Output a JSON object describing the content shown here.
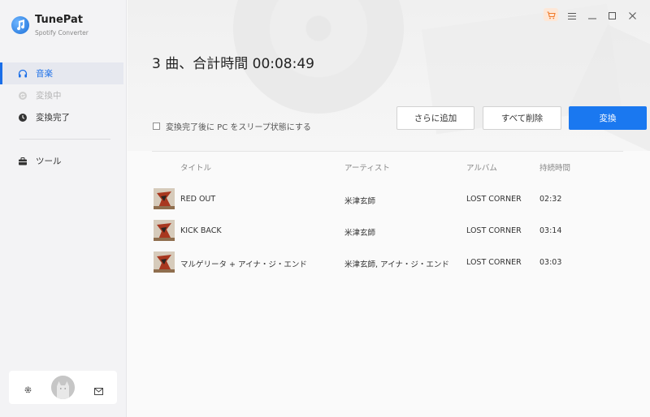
{
  "app": {
    "name": "TunePat",
    "subtitle": "Spotify Converter"
  },
  "sidebar": {
    "items": [
      {
        "label": "音楽",
        "icon": "headphones-icon",
        "state": "active"
      },
      {
        "label": "変換中",
        "icon": "converting-icon",
        "state": "disabled"
      },
      {
        "label": "変換完了",
        "icon": "clock-icon",
        "state": "normal"
      },
      {
        "label": "ツール",
        "icon": "toolbox-icon",
        "state": "normal"
      }
    ]
  },
  "main": {
    "title": "3 曲、合計時間 00:08:49",
    "sleep_option": "変換完了後に PC をスリープ状態にする",
    "add_button": "さらに追加",
    "delete_all_button": "すべて削除",
    "convert_button": "変換"
  },
  "table": {
    "headers": {
      "title": "タイトル",
      "artist": "アーティスト",
      "album": "アルバム",
      "duration": "持続時間"
    },
    "rows": [
      {
        "title": "RED OUT",
        "artist": "米津玄師",
        "album": "LOST CORNER",
        "duration": "02:32"
      },
      {
        "title": "KICK BACK",
        "artist": "米津玄師",
        "album": "LOST CORNER",
        "duration": "03:14"
      },
      {
        "title": "マルゲリータ + アイナ・ジ・エンド",
        "artist": "米津玄師, アイナ・ジ・エンド",
        "album": "LOST CORNER",
        "duration": "03:03"
      }
    ]
  },
  "colors": {
    "accent": "#1a78f0",
    "sidebar_bg": "#f3f3f5",
    "cart_bg": "#fde7d7"
  }
}
